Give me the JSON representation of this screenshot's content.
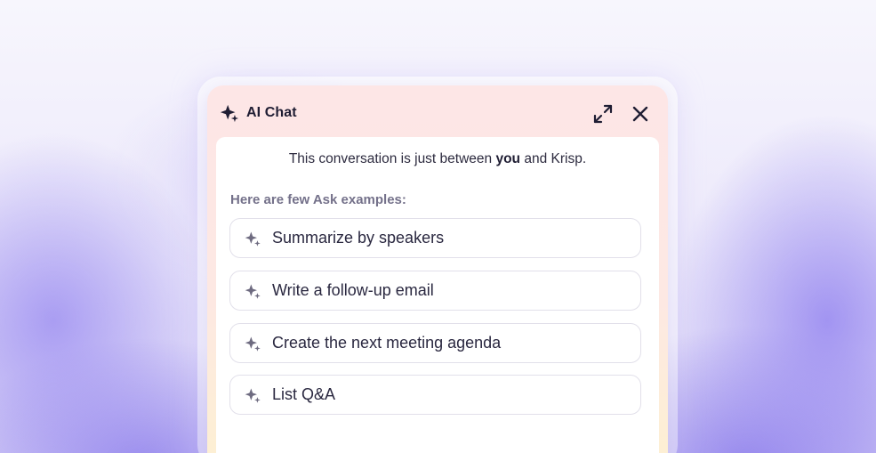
{
  "header": {
    "title": "AI Chat",
    "icon": "sparkle-icon",
    "expand_icon": "expand-icon",
    "close_icon": "close-icon"
  },
  "notice": {
    "before": "This conversation is just between ",
    "emphasis": "you",
    "after": " and Krisp."
  },
  "examples": {
    "label": "Here are few Ask examples:",
    "items": [
      {
        "label": "Summarize by speakers",
        "icon": "sparkle-icon"
      },
      {
        "label": "Write a follow-up email",
        "icon": "sparkle-icon"
      },
      {
        "label": "Create the next meeting agenda",
        "icon": "sparkle-icon"
      },
      {
        "label": "List Q&A",
        "icon": "sparkle-icon"
      }
    ]
  },
  "colors": {
    "title_text": "#1f1d33",
    "muted_text": "#74718a",
    "icon_muted": "#6e6b80",
    "panel_top": "#fde6e6",
    "panel_bottom": "#fdf0d2",
    "background_accent": "#9687f0"
  }
}
